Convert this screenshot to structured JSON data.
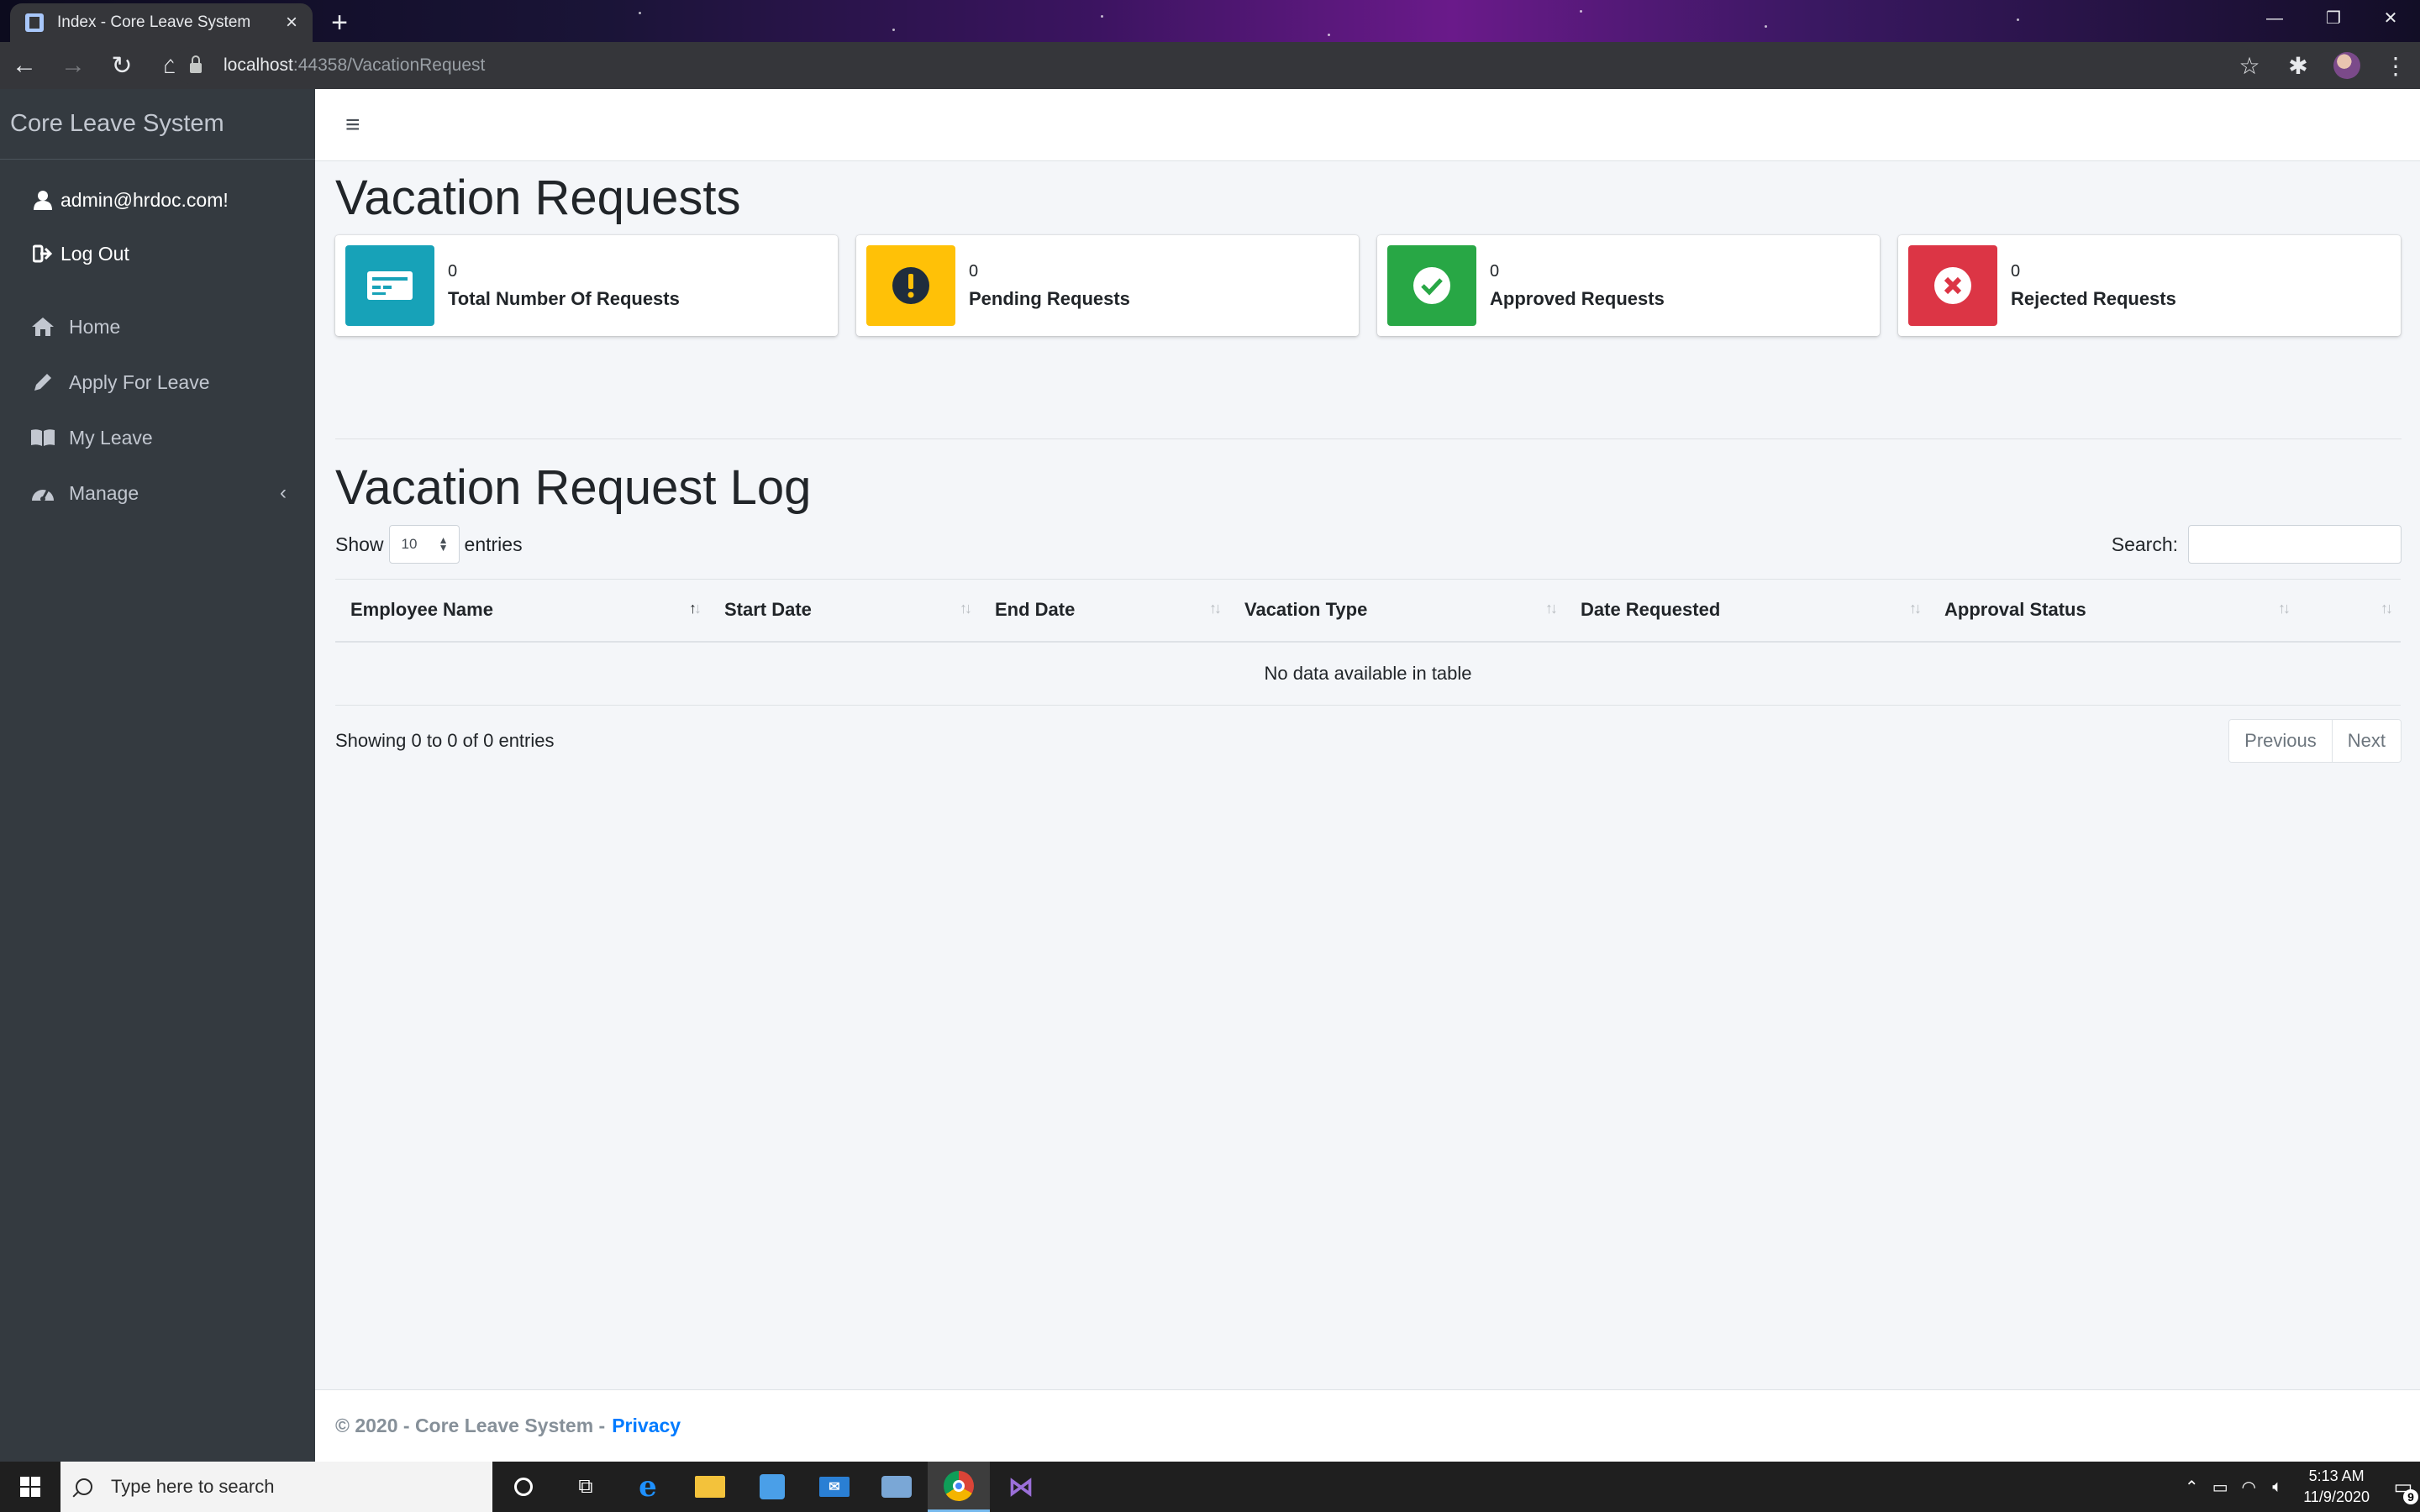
{
  "browser": {
    "tab_title": "Index - Core Leave System",
    "url_host": "localhost",
    "url_rest": ":44358/VacationRequest"
  },
  "sidebar": {
    "brand": "Core Leave System",
    "user": "admin@hrdoc.com!",
    "logout": "Log Out",
    "nav": [
      {
        "label": "Home"
      },
      {
        "label": "Apply For Leave"
      },
      {
        "label": "My Leave"
      },
      {
        "label": "Manage"
      }
    ]
  },
  "page": {
    "title": "Vacation Requests",
    "stats": [
      {
        "value": "0",
        "label": "Total Number Of Requests",
        "color": "#17a2b8",
        "icon": "id-card-icon"
      },
      {
        "value": "0",
        "label": "Pending Requests",
        "color": "#ffc107",
        "icon": "exclamation-circle-icon"
      },
      {
        "value": "0",
        "label": "Approved Requests",
        "color": "#28a745",
        "icon": "check-circle-icon"
      },
      {
        "value": "0",
        "label": "Rejected Requests",
        "color": "#dc3545",
        "icon": "times-circle-icon"
      }
    ],
    "log_title": "Vacation Request Log"
  },
  "table": {
    "show_label": "Show",
    "entries_value": "10",
    "entries_label": "entries",
    "search_label": "Search:",
    "search_value": "",
    "columns": [
      "Employee Name",
      "Start Date",
      "End Date",
      "Vacation Type",
      "Date Requested",
      "Approval Status",
      ""
    ],
    "empty_message": "No data available in table",
    "info": "Showing 0 to 0 of 0 entries",
    "prev": "Previous",
    "next": "Next"
  },
  "footer": {
    "copyright": "© 2020 - Core Leave System -",
    "privacy": "Privacy"
  },
  "taskbar": {
    "search_placeholder": "Type here to search",
    "time": "5:13 AM",
    "date": "11/9/2020",
    "notifications": "9"
  }
}
